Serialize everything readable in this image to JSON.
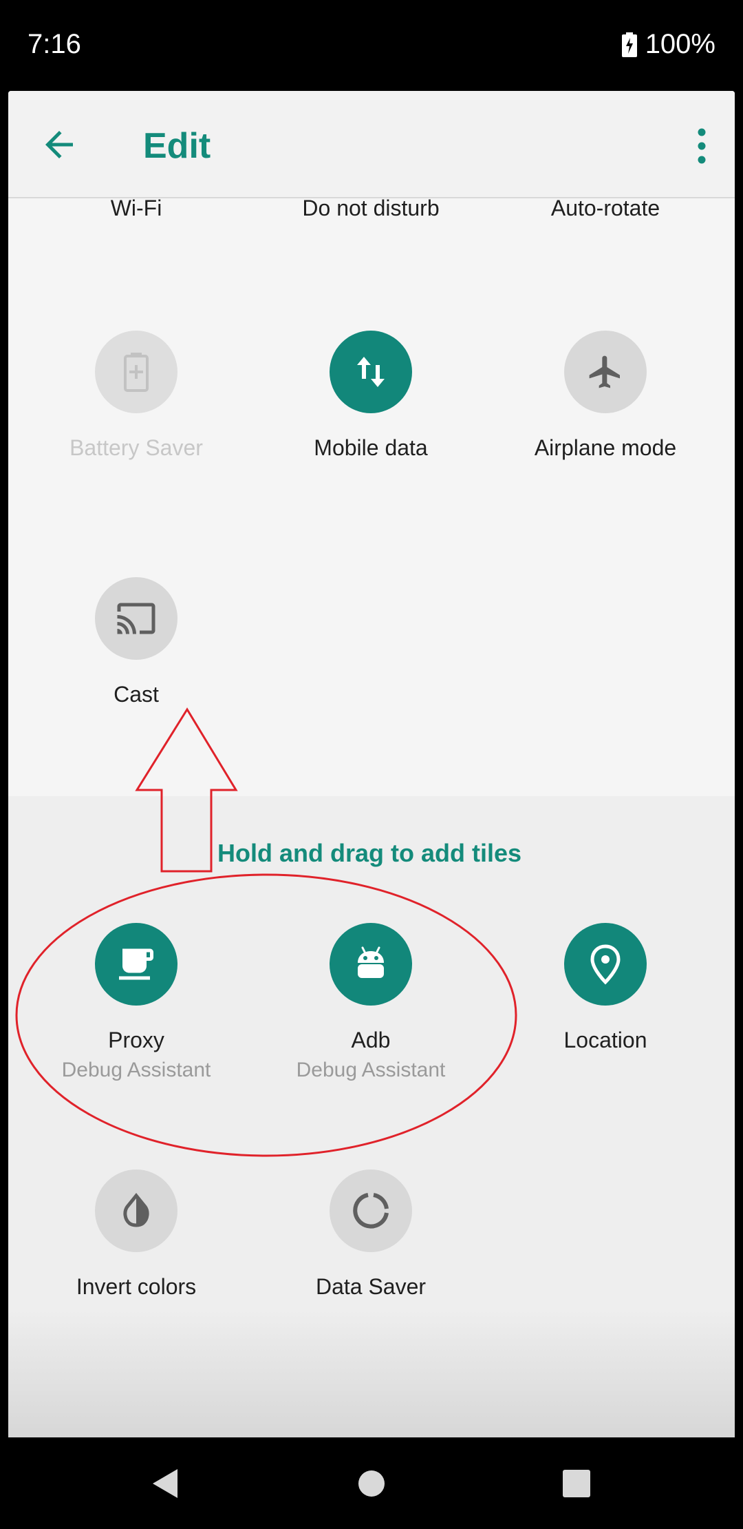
{
  "status_bar": {
    "time": "7:16",
    "battery": "100%"
  },
  "toolbar": {
    "title": "Edit"
  },
  "current_tiles": [
    {
      "label": "Wi-Fi"
    },
    {
      "label": "Do not disturb"
    },
    {
      "label": "Auto-rotate"
    },
    {
      "label": "Battery Saver",
      "icon": "battery-plus-icon"
    },
    {
      "label": "Mobile data",
      "icon": "mobile-data-icon"
    },
    {
      "label": "Airplane mode",
      "icon": "airplane-icon"
    },
    {
      "label": "Cast",
      "icon": "cast-icon"
    }
  ],
  "hint": "Hold and drag to add tiles",
  "available_tiles": [
    {
      "label": "Proxy",
      "sub": "Debug Assistant",
      "icon": "coffee-cup-icon"
    },
    {
      "label": "Adb",
      "sub": "Debug Assistant",
      "icon": "android-icon"
    },
    {
      "label": "Location",
      "icon": "location-pin-icon"
    },
    {
      "label": "Invert colors",
      "icon": "invert-colors-icon"
    },
    {
      "label": "Data Saver",
      "icon": "data-saver-icon"
    }
  ],
  "colors": {
    "accent": "#148b7b",
    "annotation": "#e0222a"
  }
}
